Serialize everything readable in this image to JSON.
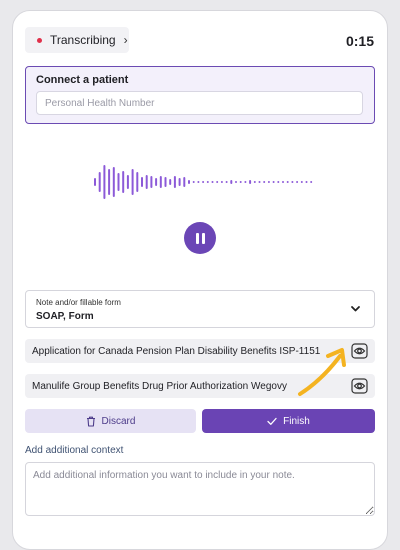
{
  "header": {
    "status_label": "Transcribing",
    "timer": "0:15"
  },
  "patient": {
    "title": "Connect a patient",
    "placeholder": "Personal Health Number"
  },
  "recorder": {
    "state": "recording",
    "control_icon": "pause-icon",
    "accent_color": "#6b46b6"
  },
  "note_form": {
    "label": "Note and/or fillable form",
    "value": "SOAP, Form"
  },
  "forms": [
    {
      "title": "Application for Canada Pension Plan Disability Benefits ISP-1151",
      "icon": "eye-icon"
    },
    {
      "title": "Manulife Group Benefits Drug Prior Authorization Wegovy",
      "icon": "eye-icon"
    }
  ],
  "actions": {
    "discard_label": "Discard",
    "finish_label": "Finish"
  },
  "context": {
    "label": "Add additional context",
    "placeholder": "Add additional information you want to include in your note."
  }
}
